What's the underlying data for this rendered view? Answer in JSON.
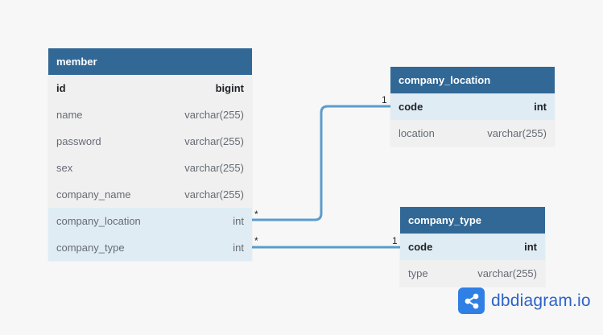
{
  "tables": {
    "member": {
      "name": "member",
      "columns": [
        {
          "name": "id",
          "type": "bigint"
        },
        {
          "name": "name",
          "type": "varchar(255)"
        },
        {
          "name": "password",
          "type": "varchar(255)"
        },
        {
          "name": "sex",
          "type": "varchar(255)"
        },
        {
          "name": "company_name",
          "type": "varchar(255)"
        },
        {
          "name": "company_location",
          "type": "int"
        },
        {
          "name": "company_type",
          "type": "int"
        }
      ]
    },
    "company_location": {
      "name": "company_location",
      "columns": [
        {
          "name": "code",
          "type": "int"
        },
        {
          "name": "location",
          "type": "varchar(255)"
        }
      ]
    },
    "company_type": {
      "name": "company_type",
      "columns": [
        {
          "name": "code",
          "type": "int"
        },
        {
          "name": "type",
          "type": "varchar(255)"
        }
      ]
    }
  },
  "relations": [
    {
      "from": "member.company_location",
      "to": "company_location.code",
      "from_label": "*",
      "to_label": "1"
    },
    {
      "from": "member.company_type",
      "to": "company_type.code",
      "from_label": "*",
      "to_label": "1"
    }
  ],
  "colors": {
    "header": "#316896",
    "row": "#f0f0f1",
    "ref_row": "#dfecf4",
    "connector": "#5b9ccb",
    "brand": "#2f7fe4"
  },
  "brand": {
    "text": "dbdiagram.io",
    "icon": "share-nodes-icon"
  }
}
